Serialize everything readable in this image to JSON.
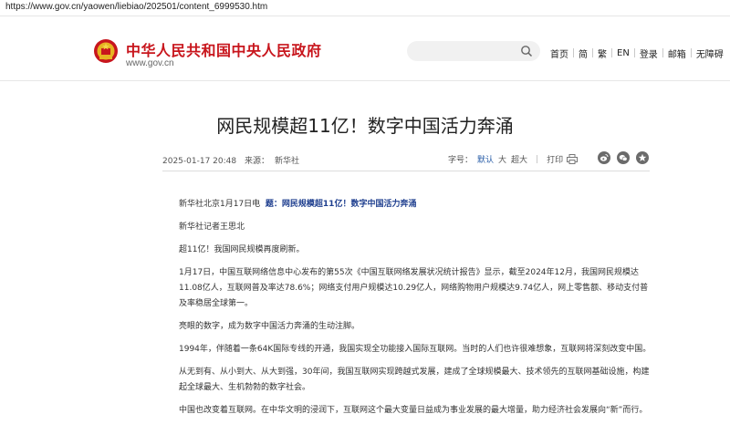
{
  "browser": {
    "url": "https://www.gov.cn/yaowen/liebiao/202501/content_6999530.htm"
  },
  "header": {
    "site_title": "中华人民共和国中央人民政府",
    "site_domain": "www.gov.cn",
    "search_placeholder": "",
    "nav": [
      "首页",
      "简",
      "繁",
      "EN",
      "登录",
      "邮箱",
      "无障碍"
    ]
  },
  "article": {
    "title": "网民规模超11亿！数字中国活力奔涌",
    "date": "2025-01-17 20:48",
    "source_label": "来源：",
    "source": "新华社",
    "font_label": "字号：",
    "font_options": [
      "默认",
      "大",
      "超大"
    ],
    "print_label": "打印",
    "paragraphs": {
      "p0_prefix": "新华社北京1月17日电",
      "p0_subhead": "题：网民规模超11亿！数字中国活力奔涌",
      "p1": "新华社记者王思北",
      "p2": "超11亿！我国网民规模再度刷新。",
      "p3": "1月17日，中国互联网络信息中心发布的第55次《中国互联网络发展状况统计报告》显示，截至2024年12月，我国网民规模达11.08亿人，互联网普及率达78.6%；网络支付用户规模达10.29亿人，网络购物用户规模达9.74亿人，网上零售额、移动支付普及率稳居全球第一。",
      "p4": "亮眼的数字，成为数字中国活力奔涌的生动注脚。",
      "p5": "1994年，伴随着一条64K国际专线的开通，我国实现全功能接入国际互联网。当时的人们也许很难想象，互联网将深刻改变中国。",
      "p6": "从无到有、从小到大、从大到强，30年间，我国互联网实现跨越式发展，建成了全球规模最大、技术领先的互联网基础设施，构建起全球最大、生机勃勃的数字社会。",
      "p7": "中国也改变着互联网。在中华文明的浸润下，互联网这个最大变量日益成为事业发展的最大增量，助力经济社会发展向“新”而行。"
    }
  },
  "colors": {
    "brand_red": "#c8161d",
    "link_blue": "#1f3f8f",
    "text": "#333333"
  }
}
